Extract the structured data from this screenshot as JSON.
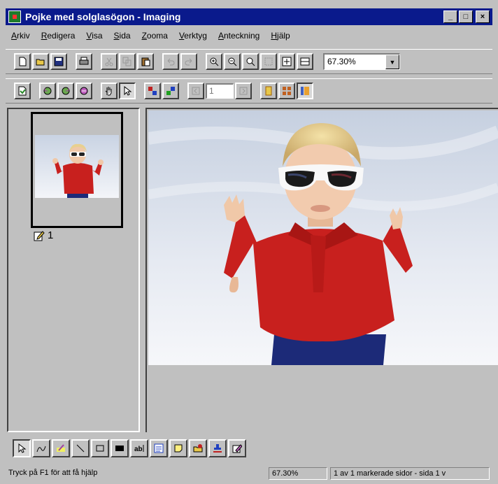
{
  "window": {
    "title": "Pojke med solglasögon - Imaging"
  },
  "window_controls": {
    "minimize": "_",
    "maximize": "□",
    "close": "×"
  },
  "menu": [
    {
      "label": "Arkiv",
      "underline": "A",
      "rest": "rkiv"
    },
    {
      "label": "Redigera",
      "underline": "R",
      "rest": "edigera"
    },
    {
      "label": "Visa",
      "underline": "V",
      "rest": "isa"
    },
    {
      "label": "Sida",
      "underline": "S",
      "rest": "ida"
    },
    {
      "label": "Zooma",
      "underline": "Z",
      "rest": "ooma"
    },
    {
      "label": "Verktyg",
      "underline": "V",
      "rest": "erktyg"
    },
    {
      "label": "Anteckning",
      "underline": "A",
      "rest": "nteckning"
    },
    {
      "label": "Hjälp",
      "underline": "H",
      "rest": "jälp"
    }
  ],
  "toolbar": {
    "zoom_value": "67.30%"
  },
  "page_toolbar": {
    "page_number": "1"
  },
  "thumbnail": {
    "label": "1"
  },
  "status": {
    "help_text": "Tryck på F1 för att få hjälp",
    "zoom": "67.30%",
    "selection": "1 av 1 markerade sidor - sida 1 v"
  },
  "colors": {
    "titlebar": "#0a1a8c",
    "face": "#c0c0c0",
    "shirt_red": "#c8201e",
    "shorts_blue": "#1c2a78"
  }
}
